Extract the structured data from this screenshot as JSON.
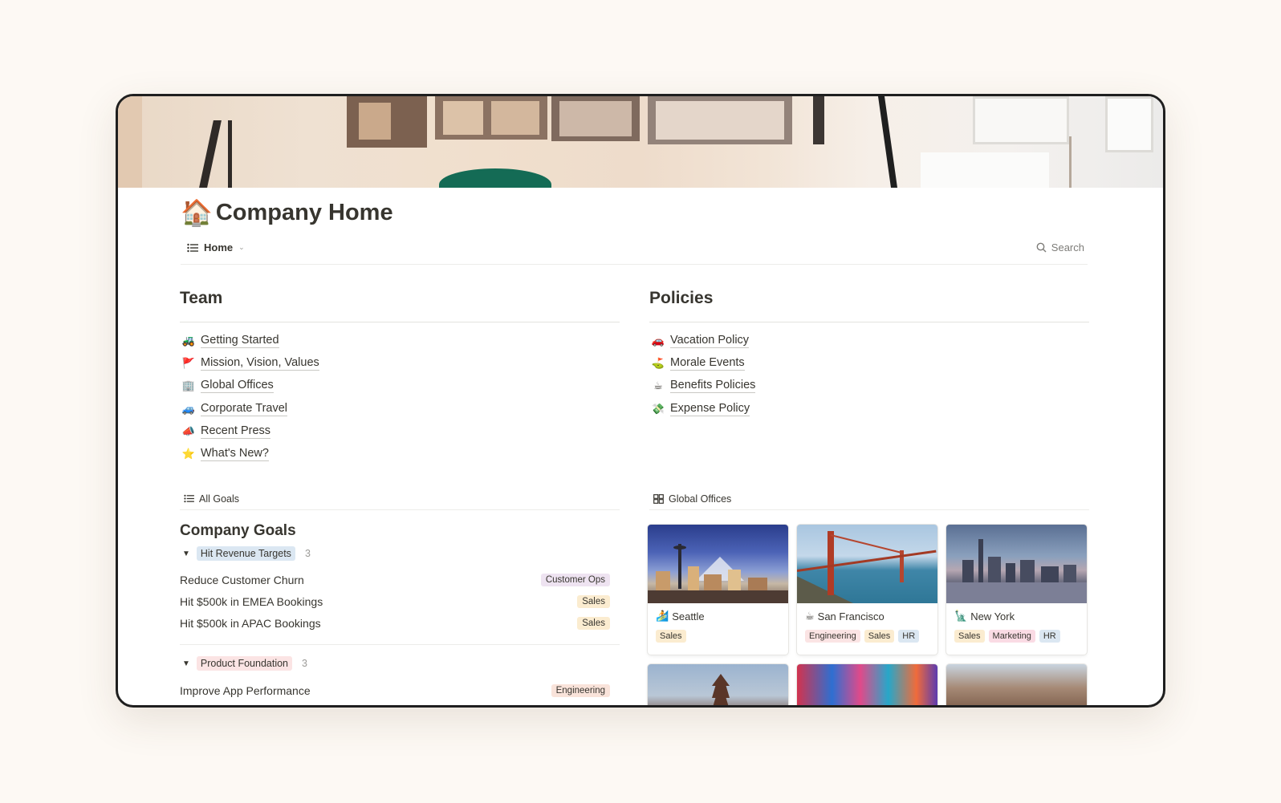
{
  "page": {
    "icon": "house-emoji",
    "icon_char": "🏠",
    "title": "Company Home"
  },
  "viewbar": {
    "tab_label": "Home",
    "tab_icon": "list-icon",
    "search_label": "Search",
    "search_icon": "search-icon"
  },
  "team": {
    "heading": "Team",
    "items": [
      {
        "emoji": "🚜",
        "label": "Getting Started"
      },
      {
        "emoji": "🚩",
        "label": "Mission, Vision, Values"
      },
      {
        "emoji": "🏢",
        "label": "Global Offices"
      },
      {
        "emoji": "🚙",
        "label": "Corporate Travel"
      },
      {
        "emoji": "📣",
        "label": "Recent Press"
      },
      {
        "emoji": "⭐",
        "label": "What's New?"
      }
    ]
  },
  "policies": {
    "heading": "Policies",
    "items": [
      {
        "emoji": "🚗",
        "label": "Vacation Policy"
      },
      {
        "emoji": "⛳",
        "label": "Morale Events"
      },
      {
        "emoji": "☕",
        "label": "Benefits Policies"
      },
      {
        "emoji": "💸",
        "label": "Expense Policy"
      }
    ]
  },
  "goals_db": {
    "view_label": "All Goals",
    "title": "Company Goals",
    "groups": [
      {
        "name": "Hit Revenue Targets",
        "count": "3",
        "color": "#dbe7f2",
        "rows": [
          {
            "label": "Reduce Customer Churn",
            "tag": "Customer Ops"
          },
          {
            "label": "Hit $500k in EMEA Bookings",
            "tag": "Sales"
          },
          {
            "label": "Hit $500k in APAC Bookings",
            "tag": "Sales"
          }
        ]
      },
      {
        "name": "Product Foundation",
        "count": "3",
        "color": "#fbe4e4",
        "rows": [
          {
            "label": "Improve App Performance",
            "tag": "Engineering"
          }
        ]
      }
    ]
  },
  "offices_db": {
    "view_label": "Global Offices",
    "view_icon": "gallery-icon",
    "cards": [
      {
        "emoji": "🏄",
        "name": "Seattle",
        "tags": [
          "Sales"
        ]
      },
      {
        "emoji": "☕",
        "name": "San Francisco",
        "tags": [
          "Engineering",
          "Sales",
          "HR"
        ]
      },
      {
        "emoji": "🗽",
        "name": "New York",
        "tags": [
          "Sales",
          "Marketing",
          "HR"
        ]
      }
    ]
  }
}
